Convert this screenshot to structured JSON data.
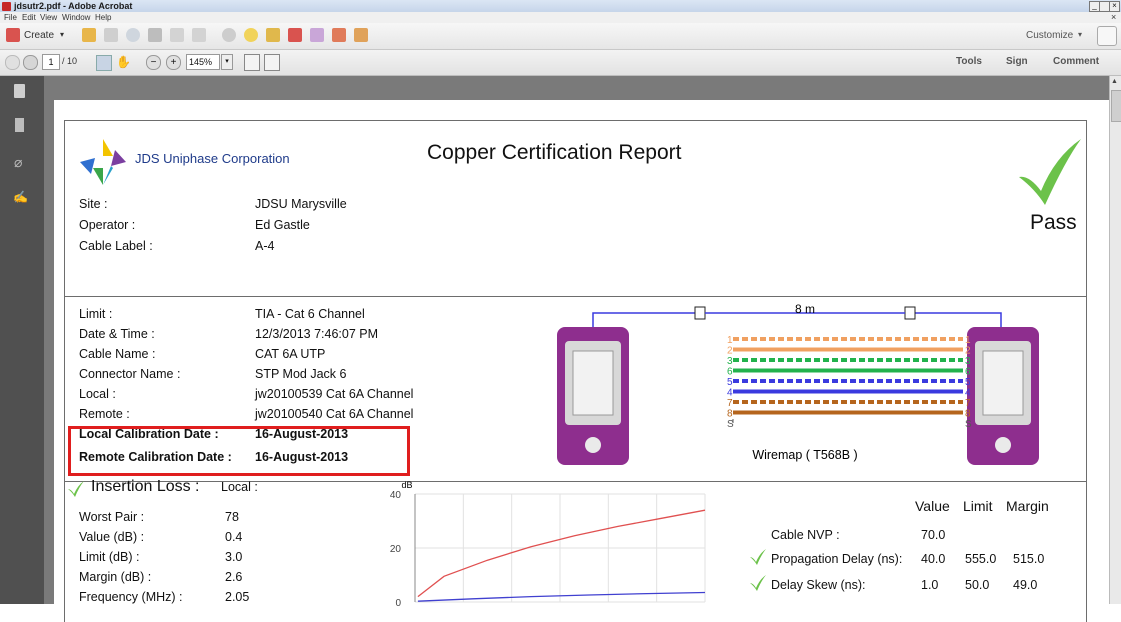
{
  "window": {
    "title": "jdsutr2.pdf - Adobe Acrobat",
    "menu": [
      "File",
      "Edit",
      "View",
      "Window",
      "Help"
    ]
  },
  "toolbar": {
    "create_label": "Create",
    "customize_label": "Customize",
    "page_current": "1",
    "page_total": "/ 10",
    "zoom": "145%",
    "tools_label": "Tools",
    "sign_label": "Sign",
    "comment_label": "Comment"
  },
  "report": {
    "company": "JDS Uniphase Corporation",
    "title": "Copper Certification Report",
    "status": "Pass",
    "header_fields": [
      {
        "label": "Site :",
        "value": "JDSU Marysville"
      },
      {
        "label": "Operator :",
        "value": "Ed Gastle"
      },
      {
        "label": "Cable Label :",
        "value": "A-4"
      }
    ],
    "details": [
      {
        "label": "Limit :",
        "value": "TIA - Cat 6 Channel"
      },
      {
        "label": "Date & Time :",
        "value": "12/3/2013 7:46:07 PM"
      },
      {
        "label": "Cable Name :",
        "value": "CAT 6A UTP"
      },
      {
        "label": "Connector Name :",
        "value": "STP Mod Jack 6"
      },
      {
        "label": "Local :",
        "value": "jw20100539 Cat 6A Channel"
      },
      {
        "label": "Remote :",
        "value": "jw20100540 Cat 6A Channel"
      }
    ],
    "calibration": [
      {
        "label": "Local Calibration Date :",
        "value": "16-August-2013"
      },
      {
        "label": "Remote Calibration Date :",
        "value": "16-August-2013"
      }
    ],
    "wiremap": {
      "length": "8 m",
      "caption": "Wiremap ( T568B )",
      "pins": [
        "1",
        "2",
        "3",
        "6",
        "5",
        "4",
        "7",
        "8",
        "S"
      ],
      "colors": {
        "orange": "#f0a060",
        "green": "#22b24c",
        "blue": "#3a3adf",
        "brown": "#b5651d",
        "tester": "#8e2e8e"
      }
    },
    "insertion_loss": {
      "title": "Insertion Loss :",
      "side": "Local :",
      "fields": [
        {
          "label": "Worst Pair :",
          "value": "78"
        },
        {
          "label": "Value  (dB) :",
          "value": "0.4"
        },
        {
          "label": "Limit  (dB) :",
          "value": "3.0"
        },
        {
          "label": "Margin  (dB) :",
          "value": "2.6"
        },
        {
          "label": "Frequency  (MHz) :",
          "value": "2.05"
        }
      ]
    },
    "results": {
      "headers": [
        "Value",
        "Limit",
        "Margin"
      ],
      "rows": [
        {
          "name": "Cable NVP :",
          "value": "70.0",
          "limit": "",
          "margin": ""
        },
        {
          "name": "Propagation Delay (ns):",
          "value": "40.0",
          "limit": "555.0",
          "margin": "515.0"
        },
        {
          "name": "Delay Skew (ns):",
          "value": "1.0",
          "limit": "50.0",
          "margin": "49.0"
        }
      ]
    }
  },
  "chart_data": {
    "type": "line",
    "ylabel": "dB",
    "yticks": [
      "40",
      "20",
      "0"
    ],
    "ylim": [
      0,
      40
    ],
    "xlim": [
      0,
      100
    ],
    "grid": true,
    "series": [
      {
        "color": "#e05050",
        "x": [
          1,
          10,
          25,
          40,
          55,
          70,
          85,
          100
        ],
        "y": [
          2,
          9.5,
          15.5,
          20.5,
          24.5,
          28,
          31,
          34
        ]
      },
      {
        "color": "#4040d0",
        "x": [
          1,
          20,
          40,
          60,
          80,
          100
        ],
        "y": [
          0.3,
          1.2,
          2,
          2.6,
          3.1,
          3.5
        ]
      }
    ]
  }
}
